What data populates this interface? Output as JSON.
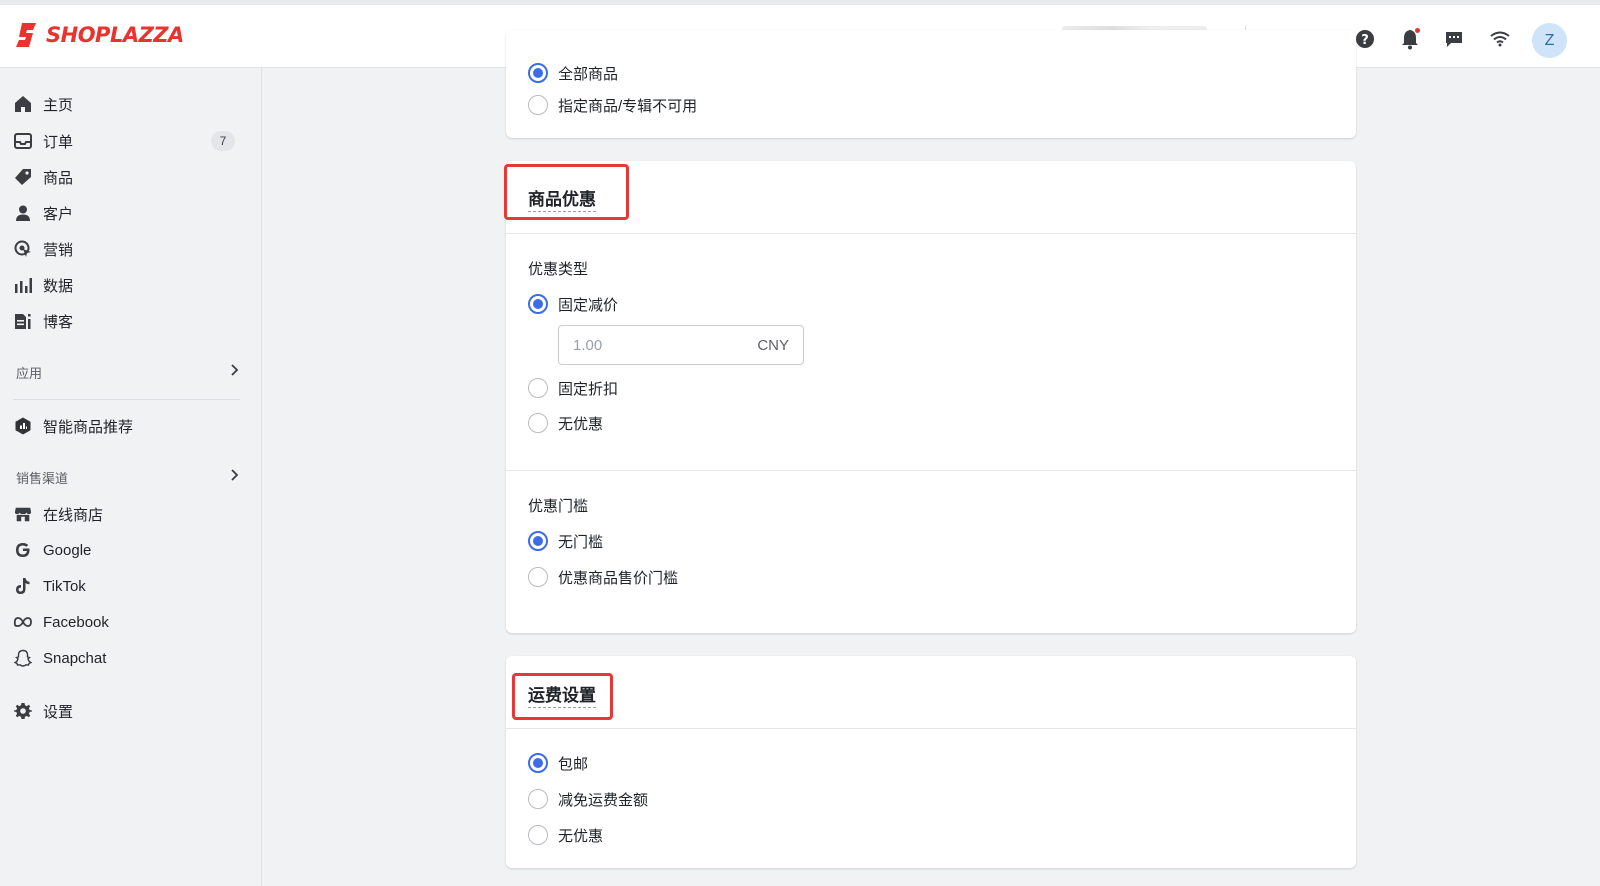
{
  "brand": {
    "name": "SHOPLAZZA",
    "color": "#e8332e"
  },
  "topbar": {
    "store_selector_icon": "chevron-down-icon",
    "icons": [
      "flag-icon",
      "storefront-icon",
      "help-icon",
      "bell-icon",
      "chat-icon",
      "wifi-icon"
    ],
    "avatar_initial": "Z"
  },
  "sidebar": {
    "items": [
      {
        "label": "主页",
        "icon": "home-icon"
      },
      {
        "label": "订单",
        "icon": "inbox-icon",
        "badge": "7"
      },
      {
        "label": "商品",
        "icon": "tag-icon"
      },
      {
        "label": "客户",
        "icon": "person-icon"
      },
      {
        "label": "营销",
        "icon": "marketing-icon"
      },
      {
        "label": "数据",
        "icon": "bar-chart-icon"
      },
      {
        "label": "博客",
        "icon": "blog-icon"
      }
    ],
    "apps_section": "应用",
    "app_items": [
      {
        "label": "智能商品推荐",
        "icon": "smart-recommend-icon"
      }
    ],
    "channels_section": "销售渠道",
    "channel_items": [
      {
        "label": "在线商店",
        "icon": "storefront-icon"
      },
      {
        "label": "Google",
        "icon": "google-icon"
      },
      {
        "label": "TikTok",
        "icon": "tiktok-icon"
      },
      {
        "label": "Facebook",
        "icon": "meta-icon"
      },
      {
        "label": "Snapchat",
        "icon": "snapchat-icon"
      }
    ],
    "settings": {
      "label": "设置",
      "icon": "gear-icon"
    }
  },
  "main": {
    "top_card": {
      "options": [
        {
          "label": "全部商品",
          "checked": true
        },
        {
          "label": "指定商品/专辑不可用",
          "checked": false
        }
      ]
    },
    "product_discount": {
      "title": "商品优惠",
      "discount_type_label": "优惠类型",
      "discount_type_options": [
        {
          "label": "固定减价",
          "checked": true
        },
        {
          "label": "固定折扣",
          "checked": false
        },
        {
          "label": "无优惠",
          "checked": false
        }
      ],
      "amount_placeholder": "1.00",
      "amount_unit": "CNY",
      "threshold_label": "优惠门槛",
      "threshold_options": [
        {
          "label": "无门槛",
          "checked": true
        },
        {
          "label": "优惠商品售价门槛",
          "checked": false
        }
      ]
    },
    "shipping": {
      "title": "运费设置",
      "options": [
        {
          "label": "包邮",
          "checked": true
        },
        {
          "label": "减免运费金额",
          "checked": false
        },
        {
          "label": "无优惠",
          "checked": false
        }
      ]
    }
  },
  "accent_color": "#3d6ce7",
  "highlight_color": "#e53935"
}
